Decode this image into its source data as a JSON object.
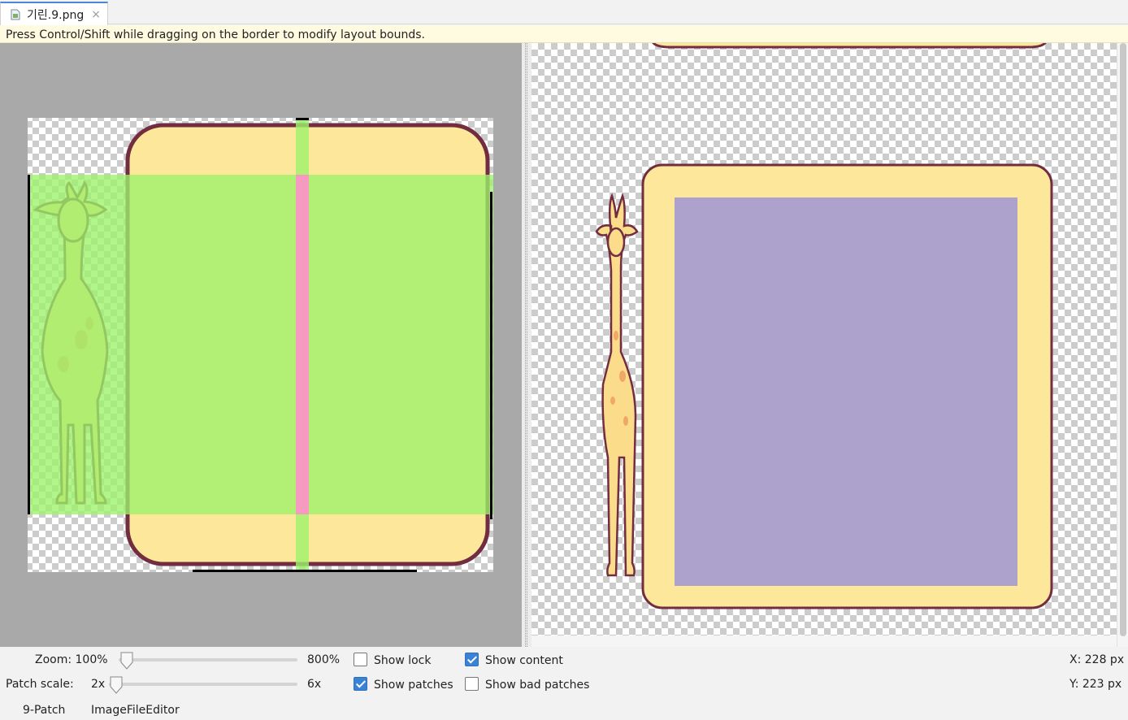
{
  "tab": {
    "label": "기린.9.png",
    "close": "×"
  },
  "hint": "Press Control/Shift while dragging on the border to modify layout bounds.",
  "zoom": {
    "label": "Zoom: 100%",
    "max": "800%",
    "value_percent": 100
  },
  "patch_scale": {
    "label": "Patch scale:",
    "min": "2x",
    "max": "6x",
    "value": 2
  },
  "options": {
    "show_lock": {
      "label": "Show lock",
      "checked": false
    },
    "show_patches": {
      "label": "Show patches",
      "checked": true
    },
    "show_content": {
      "label": "Show content",
      "checked": true
    },
    "show_bad_patches": {
      "label": "Show bad patches",
      "checked": false
    }
  },
  "coords": {
    "x": "X: 228 px",
    "y": "Y: 223 px"
  },
  "editor_tabs": [
    "9-Patch",
    "ImageFileEditor"
  ],
  "colors": {
    "frame_fill": "#fde79a",
    "frame_stroke": "#722d40",
    "patch_green": "#9cf26a",
    "patch_pink": "#f79ac2",
    "content_purple": "#ada2cb",
    "giraffe_body": "#fbdc8b",
    "giraffe_spot": "#f0a866"
  }
}
